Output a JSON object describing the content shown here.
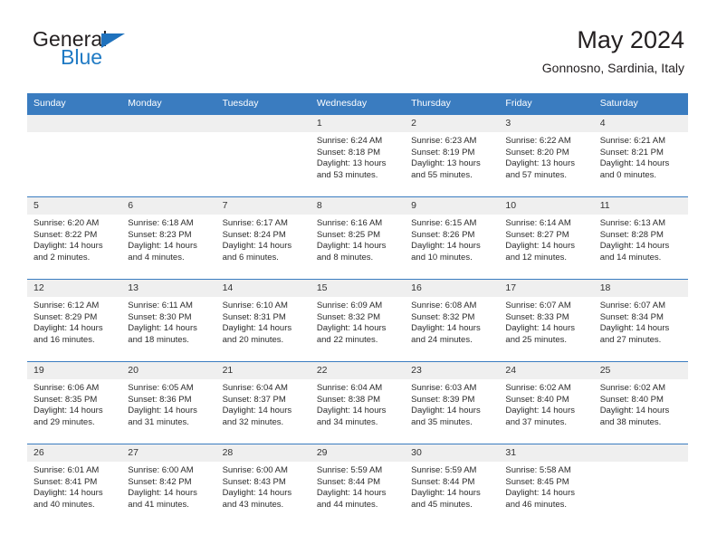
{
  "brand": {
    "word_one": "General",
    "word_two": "Blue",
    "triangle_color": "#1f72bd",
    "blue_text_color": "#1f7ac4"
  },
  "header": {
    "title": "May 2024",
    "subtitle": "Gonnosno, Sardinia, Italy"
  },
  "theme": {
    "header_bg": "#3a7cc0",
    "daynum_bg": "#efefef",
    "row_border": "#3a7cc0"
  },
  "weekday_headers": [
    "Sunday",
    "Monday",
    "Tuesday",
    "Wednesday",
    "Thursday",
    "Friday",
    "Saturday"
  ],
  "weeks": [
    [
      {
        "day": "",
        "lines": []
      },
      {
        "day": "",
        "lines": []
      },
      {
        "day": "",
        "lines": []
      },
      {
        "day": "1",
        "lines": [
          "Sunrise: 6:24 AM",
          "Sunset: 8:18 PM",
          "Daylight: 13 hours",
          "and 53 minutes."
        ]
      },
      {
        "day": "2",
        "lines": [
          "Sunrise: 6:23 AM",
          "Sunset: 8:19 PM",
          "Daylight: 13 hours",
          "and 55 minutes."
        ]
      },
      {
        "day": "3",
        "lines": [
          "Sunrise: 6:22 AM",
          "Sunset: 8:20 PM",
          "Daylight: 13 hours",
          "and 57 minutes."
        ]
      },
      {
        "day": "4",
        "lines": [
          "Sunrise: 6:21 AM",
          "Sunset: 8:21 PM",
          "Daylight: 14 hours",
          "and 0 minutes."
        ]
      }
    ],
    [
      {
        "day": "5",
        "lines": [
          "Sunrise: 6:20 AM",
          "Sunset: 8:22 PM",
          "Daylight: 14 hours",
          "and 2 minutes."
        ]
      },
      {
        "day": "6",
        "lines": [
          "Sunrise: 6:18 AM",
          "Sunset: 8:23 PM",
          "Daylight: 14 hours",
          "and 4 minutes."
        ]
      },
      {
        "day": "7",
        "lines": [
          "Sunrise: 6:17 AM",
          "Sunset: 8:24 PM",
          "Daylight: 14 hours",
          "and 6 minutes."
        ]
      },
      {
        "day": "8",
        "lines": [
          "Sunrise: 6:16 AM",
          "Sunset: 8:25 PM",
          "Daylight: 14 hours",
          "and 8 minutes."
        ]
      },
      {
        "day": "9",
        "lines": [
          "Sunrise: 6:15 AM",
          "Sunset: 8:26 PM",
          "Daylight: 14 hours",
          "and 10 minutes."
        ]
      },
      {
        "day": "10",
        "lines": [
          "Sunrise: 6:14 AM",
          "Sunset: 8:27 PM",
          "Daylight: 14 hours",
          "and 12 minutes."
        ]
      },
      {
        "day": "11",
        "lines": [
          "Sunrise: 6:13 AM",
          "Sunset: 8:28 PM",
          "Daylight: 14 hours",
          "and 14 minutes."
        ]
      }
    ],
    [
      {
        "day": "12",
        "lines": [
          "Sunrise: 6:12 AM",
          "Sunset: 8:29 PM",
          "Daylight: 14 hours",
          "and 16 minutes."
        ]
      },
      {
        "day": "13",
        "lines": [
          "Sunrise: 6:11 AM",
          "Sunset: 8:30 PM",
          "Daylight: 14 hours",
          "and 18 minutes."
        ]
      },
      {
        "day": "14",
        "lines": [
          "Sunrise: 6:10 AM",
          "Sunset: 8:31 PM",
          "Daylight: 14 hours",
          "and 20 minutes."
        ]
      },
      {
        "day": "15",
        "lines": [
          "Sunrise: 6:09 AM",
          "Sunset: 8:32 PM",
          "Daylight: 14 hours",
          "and 22 minutes."
        ]
      },
      {
        "day": "16",
        "lines": [
          "Sunrise: 6:08 AM",
          "Sunset: 8:32 PM",
          "Daylight: 14 hours",
          "and 24 minutes."
        ]
      },
      {
        "day": "17",
        "lines": [
          "Sunrise: 6:07 AM",
          "Sunset: 8:33 PM",
          "Daylight: 14 hours",
          "and 25 minutes."
        ]
      },
      {
        "day": "18",
        "lines": [
          "Sunrise: 6:07 AM",
          "Sunset: 8:34 PM",
          "Daylight: 14 hours",
          "and 27 minutes."
        ]
      }
    ],
    [
      {
        "day": "19",
        "lines": [
          "Sunrise: 6:06 AM",
          "Sunset: 8:35 PM",
          "Daylight: 14 hours",
          "and 29 minutes."
        ]
      },
      {
        "day": "20",
        "lines": [
          "Sunrise: 6:05 AM",
          "Sunset: 8:36 PM",
          "Daylight: 14 hours",
          "and 31 minutes."
        ]
      },
      {
        "day": "21",
        "lines": [
          "Sunrise: 6:04 AM",
          "Sunset: 8:37 PM",
          "Daylight: 14 hours",
          "and 32 minutes."
        ]
      },
      {
        "day": "22",
        "lines": [
          "Sunrise: 6:04 AM",
          "Sunset: 8:38 PM",
          "Daylight: 14 hours",
          "and 34 minutes."
        ]
      },
      {
        "day": "23",
        "lines": [
          "Sunrise: 6:03 AM",
          "Sunset: 8:39 PM",
          "Daylight: 14 hours",
          "and 35 minutes."
        ]
      },
      {
        "day": "24",
        "lines": [
          "Sunrise: 6:02 AM",
          "Sunset: 8:40 PM",
          "Daylight: 14 hours",
          "and 37 minutes."
        ]
      },
      {
        "day": "25",
        "lines": [
          "Sunrise: 6:02 AM",
          "Sunset: 8:40 PM",
          "Daylight: 14 hours",
          "and 38 minutes."
        ]
      }
    ],
    [
      {
        "day": "26",
        "lines": [
          "Sunrise: 6:01 AM",
          "Sunset: 8:41 PM",
          "Daylight: 14 hours",
          "and 40 minutes."
        ]
      },
      {
        "day": "27",
        "lines": [
          "Sunrise: 6:00 AM",
          "Sunset: 8:42 PM",
          "Daylight: 14 hours",
          "and 41 minutes."
        ]
      },
      {
        "day": "28",
        "lines": [
          "Sunrise: 6:00 AM",
          "Sunset: 8:43 PM",
          "Daylight: 14 hours",
          "and 43 minutes."
        ]
      },
      {
        "day": "29",
        "lines": [
          "Sunrise: 5:59 AM",
          "Sunset: 8:44 PM",
          "Daylight: 14 hours",
          "and 44 minutes."
        ]
      },
      {
        "day": "30",
        "lines": [
          "Sunrise: 5:59 AM",
          "Sunset: 8:44 PM",
          "Daylight: 14 hours",
          "and 45 minutes."
        ]
      },
      {
        "day": "31",
        "lines": [
          "Sunrise: 5:58 AM",
          "Sunset: 8:45 PM",
          "Daylight: 14 hours",
          "and 46 minutes."
        ]
      },
      {
        "day": "",
        "lines": []
      }
    ]
  ]
}
